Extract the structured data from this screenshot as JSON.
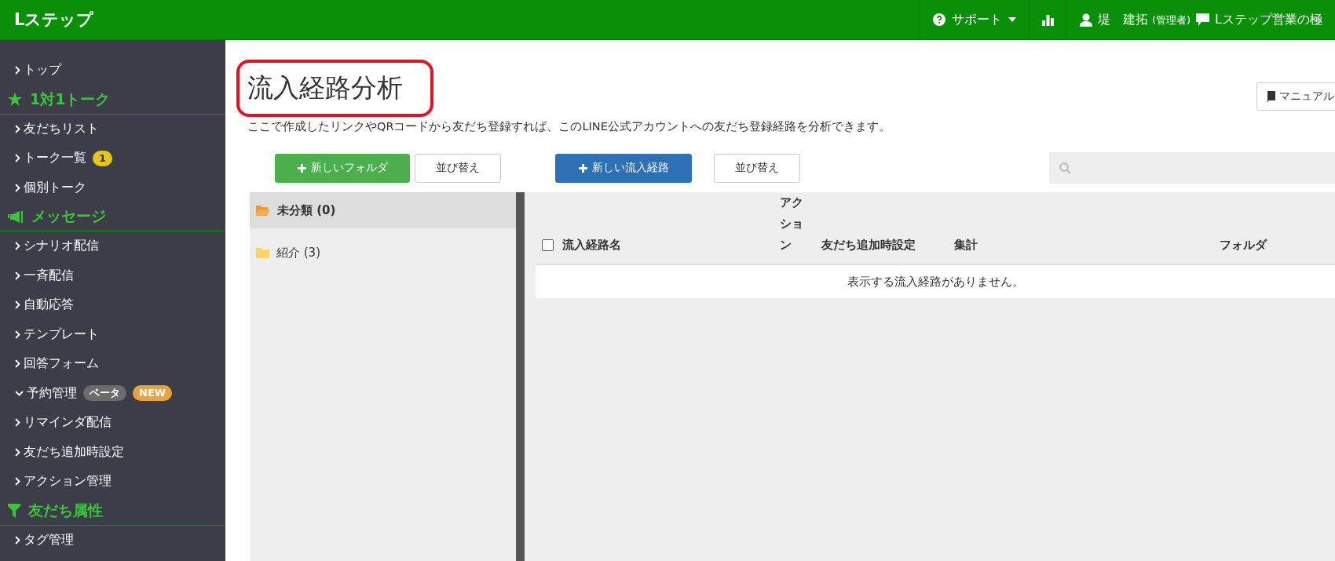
{
  "topbar": {
    "logo": "Lステップ",
    "nav": [
      {
        "kind": "menu",
        "label": "サポート"
      },
      {
        "kind": "chart"
      },
      {
        "kind": "user",
        "label": "堤　建拓",
        "note": "(管理者)"
      },
      {
        "kind": "message",
        "label": "Lステップ営業の極"
      }
    ]
  },
  "sidebar": {
    "items": [
      {
        "kind": "link",
        "label": "トップ",
        "expanded": false
      },
      {
        "kind": "heading",
        "label": "1対1トーク"
      },
      {
        "kind": "link",
        "label": "友だちリスト",
        "expanded": false
      },
      {
        "kind": "link",
        "label": "トーク一覧",
        "expanded": false,
        "badges": [
          {
            "label": "1",
            "color": "#e8c51c"
          }
        ]
      },
      {
        "kind": "link",
        "label": "個別トーク",
        "expanded": false
      },
      {
        "kind": "heading",
        "label": "メッセージ"
      },
      {
        "kind": "link",
        "label": "シナリオ配信",
        "expanded": false
      },
      {
        "kind": "link",
        "label": "一斉配信",
        "expanded": false
      },
      {
        "kind": "link",
        "label": "自動応答",
        "expanded": false
      },
      {
        "kind": "link",
        "label": "テンプレート",
        "expanded": false
      },
      {
        "kind": "link",
        "label": "回答フォーム",
        "expanded": false
      },
      {
        "kind": "link",
        "label": "予約管理",
        "expanded": true,
        "badges": [
          {
            "label": "ベータ",
            "color": "#6c6c6c"
          },
          {
            "label": "NEW",
            "color": "#eaa23c"
          }
        ]
      },
      {
        "kind": "link",
        "label": "リマインダ配信",
        "expanded": false
      },
      {
        "kind": "link",
        "label": "友だち追加時設定",
        "expanded": false
      },
      {
        "kind": "link",
        "label": "アクション管理",
        "expanded": false
      },
      {
        "kind": "heading",
        "label": "友だち属性"
      },
      {
        "kind": "link",
        "label": "タグ管理",
        "expanded": false
      }
    ]
  },
  "main": {
    "title": "流入経路分析",
    "manual_button": "マニュアル",
    "description": "ここで作成したリンクやQRコードから友だち登録すれば、このLINE公式アカウントへの友だち登録経路を分析できます。",
    "buttons": [
      {
        "kind": "success",
        "label": "新しいフォルダ"
      },
      {
        "kind": "default",
        "label": "並び替え"
      },
      {
        "kind": "primary",
        "label": "新しい流入経路"
      },
      {
        "kind": "default",
        "label": "並び替え"
      }
    ],
    "folders": [
      {
        "label": "未分類 (0)",
        "selected": true
      },
      {
        "label": "紹介 (3)",
        "selected": false
      }
    ],
    "table": {
      "select_all_checked": false,
      "columns": [
        "流入経路名",
        "アクション",
        "友だち追加時設定",
        "集計",
        "フォルダ"
      ],
      "empty_message": "表示する流入経路がありません。"
    }
  }
}
